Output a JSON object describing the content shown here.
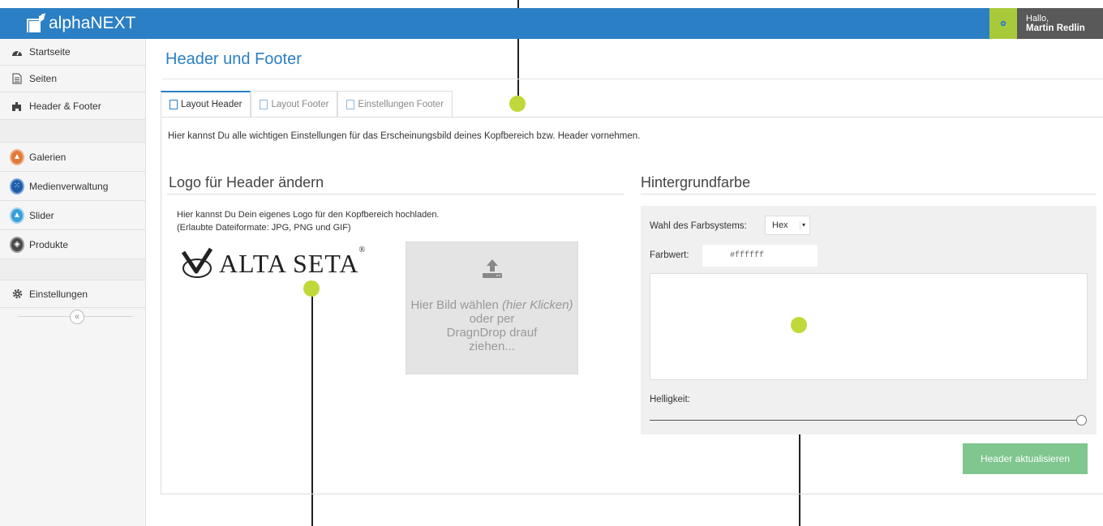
{
  "app": {
    "name": "alphaNEXT",
    "greeting": "Hallo,",
    "user_name": "Martin Redlin"
  },
  "sidebar": {
    "items": [
      {
        "label": "Startseite",
        "icon": "tachometer-icon"
      },
      {
        "label": "Seiten",
        "icon": "document-icon"
      },
      {
        "label": "Header & Footer",
        "icon": "puzzle-icon"
      },
      {
        "label": "Galerien",
        "icon": "gallery-icon"
      },
      {
        "label": "Medienverwaltung",
        "icon": "grid-apps-icon"
      },
      {
        "label": "Slider",
        "icon": "slider-icon"
      },
      {
        "label": "Produkte",
        "icon": "box-icon"
      },
      {
        "label": "Einstellungen",
        "icon": "gear-icon"
      }
    ],
    "collapse_symbol": "«"
  },
  "main": {
    "title": "Header und Footer",
    "tabs": [
      {
        "label": "Layout Header",
        "active": true
      },
      {
        "label": "Layout Footer",
        "active": false
      },
      {
        "label": "Einstellungen Footer",
        "active": false
      }
    ],
    "intro": "Hier kannst Du alle wichtigen Einstellungen für das Erscheinungsbild deines Kopfbereich bzw. Header vornehmen.",
    "logo_section": {
      "title": "Logo für Header ändern",
      "description": "Hier kannst Du Dein eigenes Logo für den Kopfbereich hochladen. (Erlaubte Dateiformate: JPG, PNG und GIF)",
      "current_logo_text": "ALTA SETA",
      "current_logo_mark": "®",
      "dropzone_line1": "Hier Bild wählen",
      "dropzone_line1_italic": "(hier Klicken)",
      "dropzone_line2": "oder per DragnDrop drauf ziehen..."
    },
    "bg_section": {
      "title": "Hintergrundfarbe",
      "color_system_label": "Wahl des Farbsystems:",
      "color_system_value": "Hex",
      "color_value_label": "Farbwert:",
      "color_value": "#ffffff",
      "brightness_label": "Helligkeit:",
      "brightness": 1.0
    },
    "submit_label": "Header aktualisieren"
  },
  "colors": {
    "primary": "#2b7fc4",
    "accent": "#a8c93a",
    "button": "#7fc68f",
    "marker": "#c1d83a"
  }
}
